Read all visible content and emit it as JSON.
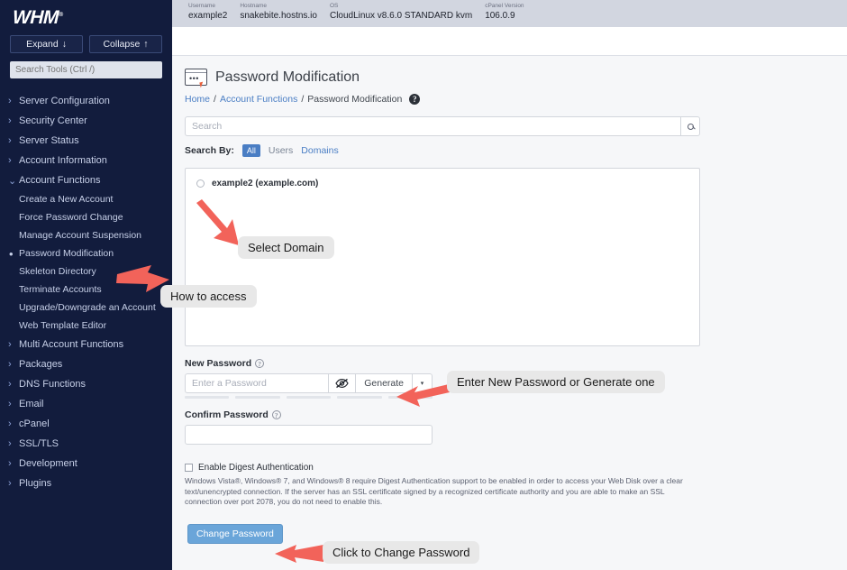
{
  "sidebar": {
    "logo": "WHM",
    "logo_mark": "®",
    "expand_label": "Expand",
    "expand_icon": "↓",
    "collapse_label": "Collapse",
    "collapse_icon": "↑",
    "search_placeholder": "Search Tools (Ctrl /)",
    "chevron_right": "›",
    "chevron_down": "⌄",
    "active_dot": "•",
    "menu": [
      {
        "label": "Server Configuration",
        "expanded": false
      },
      {
        "label": "Security Center",
        "expanded": false
      },
      {
        "label": "Server Status",
        "expanded": false
      },
      {
        "label": "Account Information",
        "expanded": false
      },
      {
        "label": "Account Functions",
        "expanded": true
      }
    ],
    "submenu": [
      {
        "label": "Create a New Account",
        "active": false
      },
      {
        "label": "Force Password Change",
        "active": false
      },
      {
        "label": "Manage Account Suspension",
        "active": false
      },
      {
        "label": "Password Modification",
        "active": true
      },
      {
        "label": "Skeleton Directory",
        "active": false
      },
      {
        "label": "Terminate Accounts",
        "active": false
      },
      {
        "label": "Upgrade/Downgrade an Account",
        "active": false
      },
      {
        "label": "Web Template Editor",
        "active": false
      }
    ],
    "menu_bottom": [
      {
        "label": "Multi Account Functions"
      },
      {
        "label": "Packages"
      },
      {
        "label": "DNS Functions"
      },
      {
        "label": "Email"
      },
      {
        "label": "cPanel"
      },
      {
        "label": "SSL/TLS"
      },
      {
        "label": "Development"
      },
      {
        "label": "Plugins"
      }
    ]
  },
  "topbar": {
    "items": [
      {
        "label": "Username",
        "value": "example2"
      },
      {
        "label": "Hostname",
        "value": "snakebite.hostns.io"
      },
      {
        "label": "OS",
        "value": "CloudLinux v8.6.0 STANDARD kvm"
      },
      {
        "label": "cPanel Version",
        "value": "106.0.9"
      }
    ]
  },
  "page": {
    "title": "Password Modification",
    "icon_dots": "•••",
    "breadcrumb": {
      "home": "Home",
      "parent": "Account Functions",
      "current": "Password Modification",
      "separator": "/",
      "help": "?"
    }
  },
  "search": {
    "placeholder": "Search",
    "search_icon": "search-icon",
    "search_by_label": "Search By:",
    "filters": [
      {
        "label": "All",
        "active": true
      },
      {
        "label": "Users",
        "active": false
      },
      {
        "label": "Domains",
        "active": false
      }
    ]
  },
  "account_list": {
    "accounts": [
      {
        "label": "example2 (example.com)",
        "selected": false
      }
    ]
  },
  "form": {
    "new_password_label": "New Password",
    "new_password_placeholder": "Enter a Password",
    "new_password_value": "",
    "generate_label": "Generate",
    "caret_icon": "▾",
    "eye_icon": "eye-slash-icon",
    "help_icon": "?",
    "strength_segments": 5,
    "confirm_password_label": "Confirm Password",
    "confirm_password_value": "",
    "digest_label": "Enable Digest Authentication",
    "digest_checked": false,
    "digest_description": "Windows Vista®, Windows® 7, and Windows® 8 require Digest Authentication support to be enabled in order to access your Web Disk over a clear text/unencrypted connection. If the server has an SSL certificate signed by a recognized certificate authority and you are able to make an SSL connection over port 2078, you do not need to enable this.",
    "submit_label": "Change Password"
  },
  "annotations": [
    {
      "text": "Select Domain"
    },
    {
      "text": "How to access"
    },
    {
      "text": "Enter New Password or Generate one"
    },
    {
      "text": "Click to Change Password"
    }
  ],
  "colors": {
    "sidebar_bg": "#121c3d",
    "accent_blue": "#4a7ec4",
    "button_blue": "#6aa5d9",
    "annotation_red": "#f2635a",
    "topbar_bg": "#d2d6e0"
  }
}
